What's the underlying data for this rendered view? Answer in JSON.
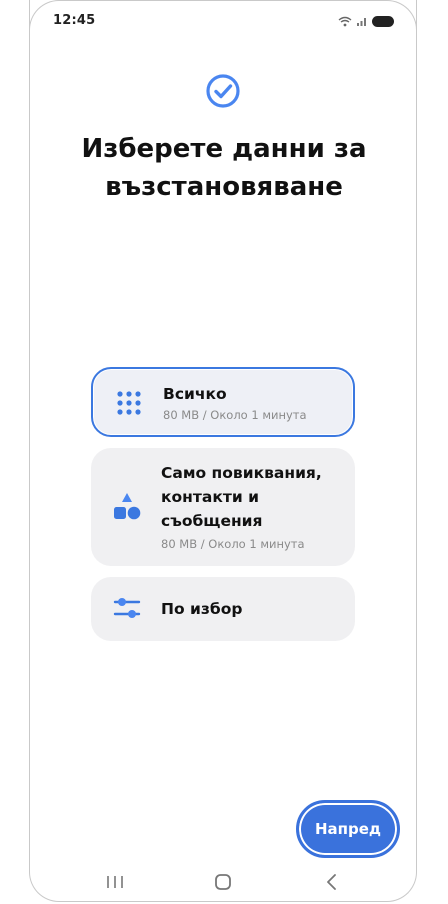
{
  "status_bar": {
    "time": "12:45"
  },
  "page": {
    "title_line1": "Изберете данни за",
    "title_line2": "възстановяване",
    "accent_color": "#3b78e0"
  },
  "options": [
    {
      "title": "Всичко",
      "subtitle": "80 MB / Около 1 минута",
      "selected": true,
      "icon": "grid-dots-icon"
    },
    {
      "title_line1": "Само повиквания,",
      "title_line2": "контакти и",
      "title_line3": "съобщения",
      "subtitle": "80 MB / Около 1 минута",
      "selected": false,
      "icon": "shapes-icon"
    },
    {
      "title": "По избор",
      "selected": false,
      "icon": "sliders-icon"
    }
  ],
  "footer": {
    "next_label": "Напред"
  },
  "nav_bar": {
    "recents": "recents-icon",
    "home": "home-icon",
    "back": "back-icon"
  }
}
